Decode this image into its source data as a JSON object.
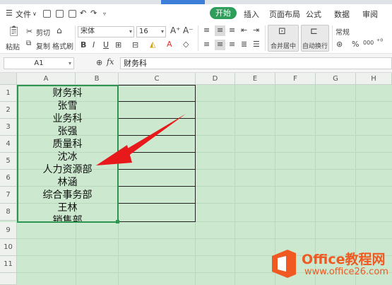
{
  "menubar": {
    "file": "文件",
    "tabs": [
      "开始",
      "插入",
      "页面布局",
      "公式",
      "数据",
      "审阅"
    ]
  },
  "ribbon": {
    "paste": "粘贴",
    "cut": "剪切",
    "copy": "复制",
    "format_painter": "格式刷",
    "font_name": "宋体",
    "font_size": "16",
    "merge_center": "合并居中",
    "auto_wrap": "自动换行",
    "number_format": "常规",
    "percent": "%",
    "thousands": "000"
  },
  "formula_bar": {
    "name_box": "A1",
    "fx": "fx",
    "content": "财务科"
  },
  "grid": {
    "columns": [
      "A",
      "B",
      "C",
      "D",
      "E",
      "F",
      "G",
      "H"
    ],
    "rows": [
      "1",
      "2",
      "3",
      "4",
      "5",
      "6",
      "7",
      "8",
      "9",
      "10",
      "11"
    ],
    "cells_a": [
      "财务科",
      "张雪",
      "业务科",
      "张强",
      "质量科",
      "沈冰",
      "人力资源部",
      "林涵",
      "综合事务部",
      "王林",
      "销售部"
    ]
  },
  "watermark": {
    "line1": "Office教程网",
    "line2": "www.office26.com"
  },
  "colors": {
    "sheet_background": "#cce8cf",
    "active_tab": "#2f9e5b",
    "selection_border": "#2e9550",
    "arrow": "#e8191a",
    "watermark": "#f05a22"
  }
}
